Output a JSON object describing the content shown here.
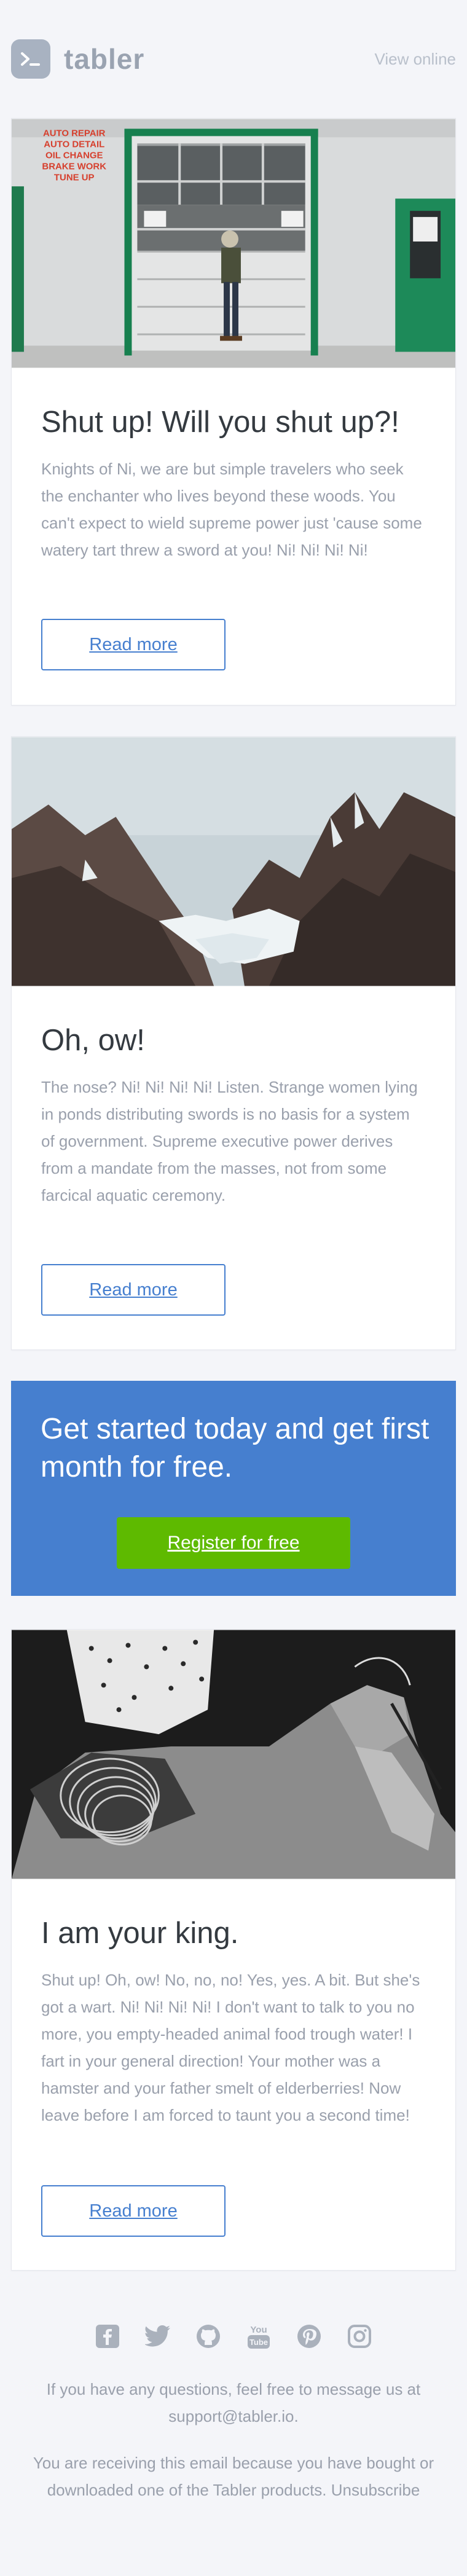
{
  "header": {
    "brand_name": "tabler",
    "view_online": "View online"
  },
  "articles": [
    {
      "title": "Shut up! Will you shut up?!",
      "text": "Knights of Ni, we are but simple travelers who seek the enchanter who lives beyond these woods. You can't expect to wield supreme power just 'cause some watery tart threw a sword at you! Ni! Ni! Ni! Ni!",
      "button": "Read more",
      "image": {
        "shop_sign_lines": [
          "AUTO REPAIR",
          "AUTO DETAIL",
          "OIL CHANGE",
          "BRAKE WORK",
          "TUNE UP"
        ]
      }
    },
    {
      "title": "Oh, ow!",
      "text": "The nose? Ni! Ni! Ni! Ni! Listen. Strange women lying in ponds distributing swords is no basis for a system of government. Supreme executive power derives from a mandate from the masses, not from some farcical aquatic ceremony.",
      "button": "Read more"
    },
    {
      "title": "I am your king.",
      "text": "Shut up! Oh, ow! No, no, no! Yes, yes. A bit. But she's got a wart. Ni! Ni! Ni! Ni! I don't want to talk to you no more, you empty-headed animal food trough water! I fart in your general direction! Your mother was a hamster and your father smelt of elderberries! Now leave before I am forced to taunt you a second time!",
      "button": "Read more"
    }
  ],
  "promo": {
    "title": "Get started today and get first month for free.",
    "button": "Register for free"
  },
  "footer": {
    "social_icons": [
      "facebook-icon",
      "twitter-icon",
      "github-icon",
      "youtube-icon",
      "pinterest-icon",
      "instagram-icon"
    ],
    "youtube_label": "You",
    "contact_text": "If you have any questions, feel free to message us at",
    "contact_email": "support@tabler.io.",
    "notice_text": "You are receiving this email because you have bought or downloaded one of the Tabler products.",
    "unsubscribe": "Unsubscribe"
  },
  "colors": {
    "background": "#f4f5f9",
    "primary": "#467fcf",
    "success": "#5eba00",
    "muted": "#9aa0ac"
  }
}
